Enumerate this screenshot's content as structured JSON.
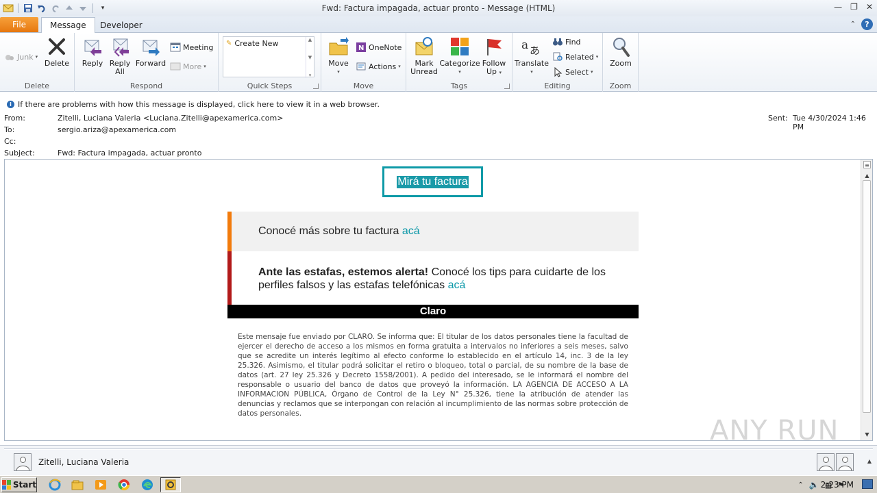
{
  "window": {
    "title": "Fwd: Factura impagada, actuar pronto  -  Message (HTML)"
  },
  "tabs": [
    {
      "label": "File"
    },
    {
      "label": "Message"
    },
    {
      "label": "Developer"
    }
  ],
  "ribbon": {
    "delete_group": {
      "label": "Delete",
      "junk": "Junk",
      "delete": "Delete"
    },
    "respond_group": {
      "label": "Respond",
      "reply": "Reply",
      "reply_all_1": "Reply",
      "reply_all_2": "All",
      "forward": "Forward",
      "meeting": "Meeting",
      "more": "More"
    },
    "quick_steps_group": {
      "label": "Quick Steps",
      "create_new": "Create New"
    },
    "move_group": {
      "label": "Move",
      "move": "Move",
      "onenote": "OneNote",
      "actions": "Actions"
    },
    "tags_group": {
      "label": "Tags",
      "mark_unread_1": "Mark",
      "mark_unread_2": "Unread",
      "categorize": "Categorize",
      "follow_up_1": "Follow",
      "follow_up_2": "Up"
    },
    "editing_group": {
      "label": "Editing",
      "translate": "Translate",
      "find": "Find",
      "related": "Related",
      "select": "Select"
    },
    "zoom_group": {
      "label": "Zoom",
      "zoom": "Zoom"
    }
  },
  "infobar": {
    "text": "If there are problems with how this message is displayed, click here to view it in a web browser."
  },
  "header": {
    "from_label": "From:",
    "from_value": "Zitelli, Luciana Valeria <Luciana.Zitelli@apexamerica.com>",
    "to_label": "To:",
    "to_value": "sergio.ariza@apexamerica.com",
    "cc_label": "Cc:",
    "subject_label": "Subject:",
    "subject_value": "Fwd: Factura impagada, actuar pronto",
    "sent_label": "Sent:",
    "sent_value": "Tue 4/30/2024 1:46 PM"
  },
  "body": {
    "cta": "Mirá tu factura",
    "card1_text": "Conocé más sobre tu factura ",
    "card1_link": "acá",
    "card2_bold": "Ante las estafas, estemos alerta!",
    "card2_text": " Conocé los tips para cuidarte de los perfiles falsos y las estafas telefónicas ",
    "card2_link": "acá",
    "brand": "Claro",
    "legal": "Este mensaje fue enviado por CLARO. Se informa que: El titular de los datos personales tiene la facultad de ejercer el derecho de acceso a los mismos en forma gratuita a intervalos no inferiores a seis meses, salvo que se acredite un interés legítimo al efecto conforme lo establecido en el artículo 14, inc. 3 de la ley 25.326. Asimismo, el titular podrá solicitar el retiro o bloqueo, total o parcial, de su nombre de la base de datos (art. 27 ley 25.326 y Decreto 1558/2001). A pedido del interesado, se le informará el nombre del responsable o usuario del banco de datos que proveyó la información. LA AGENCIA DE ACCESO A LA INFORMACION PÚBLICA, Órgano de Control de la Ley N° 25.326, tiene la atribución de atender las denuncias y reclamos que se interpongan con relación al incumplimiento de las normas sobre protección de datos personales."
  },
  "watermark": "ANY RUN",
  "people_pane": {
    "name": "Zitelli, Luciana Valeria"
  },
  "taskbar": {
    "start": "Start",
    "clock": "2:23 PM"
  },
  "colors": {
    "accent_teal": "#0b98a8",
    "orange_bar": "#f27b0c",
    "red_bar": "#b21a1a",
    "file_tab": "#e6770f"
  }
}
